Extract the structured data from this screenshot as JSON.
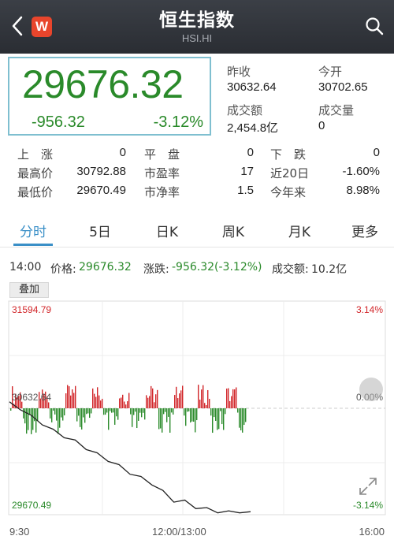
{
  "header": {
    "title": "恒生指数",
    "subtitle": "HSI.HI",
    "logo_text": "W"
  },
  "quote": {
    "price": "29676.32",
    "change": "-956.32",
    "change_pct": "-3.12%"
  },
  "summary": [
    {
      "label": "昨收",
      "value": "30632.64"
    },
    {
      "label": "今开",
      "value": "30702.65"
    },
    {
      "label": "成交额",
      "value": "2,454.8亿"
    },
    {
      "label": "成交量",
      "value": "0"
    }
  ],
  "stats": [
    [
      {
        "label": "上　涨",
        "value": "0"
      },
      {
        "label": "平　盘",
        "value": "0"
      },
      {
        "label": "下　跌",
        "value": "0"
      }
    ],
    [
      {
        "label": "最高价",
        "value": "30792.88"
      },
      {
        "label": "市盈率",
        "value": "17"
      },
      {
        "label": "近20日",
        "value": "-1.60%"
      }
    ],
    [
      {
        "label": "最低价",
        "value": "29670.49"
      },
      {
        "label": "市净率",
        "value": "1.5"
      },
      {
        "label": "今年来",
        "value": "8.98%"
      }
    ]
  ],
  "tabs": [
    "分时",
    "5日",
    "日K",
    "周K",
    "月K",
    "更多"
  ],
  "active_tab": "分时",
  "info": {
    "time": "14:00",
    "price_label": "价格:",
    "price_value": "29676.32",
    "change_label": "涨跌:",
    "change_value": "-956.32(-3.12%)",
    "turnover_label": "成交额:",
    "turnover_value": "10.2亿"
  },
  "overlay_button": "叠加",
  "chart_labels": {
    "y_top": "31594.79",
    "y_mid": "30632.64",
    "y_bottom": "29670.49",
    "pct_top": "3.14%",
    "pct_mid": "0.00%",
    "pct_bottom": "-3.14%",
    "x_start": "9:30",
    "x_mid": "12:00/13:00",
    "x_end": "16:00"
  },
  "colors": {
    "up": "#d2262a",
    "down": "#2a8a2a",
    "accent": "#3a8fc7",
    "header_bg": "#33363c"
  },
  "chart_data": {
    "type": "line",
    "ylim": [
      29670.49,
      31594.79
    ],
    "reference": 30632.64,
    "x_ticks": [
      "9:30",
      "12:00/13:00",
      "16:00"
    ],
    "series": [
      {
        "values": [
          30700,
          30640,
          30560,
          30500,
          30430,
          30380,
          30330,
          30270,
          30210,
          30160,
          30100,
          30040,
          29990,
          29940,
          29860,
          29780,
          29770,
          29720,
          29700,
          29680,
          29670,
          29680,
          29676
        ]
      }
    ]
  }
}
